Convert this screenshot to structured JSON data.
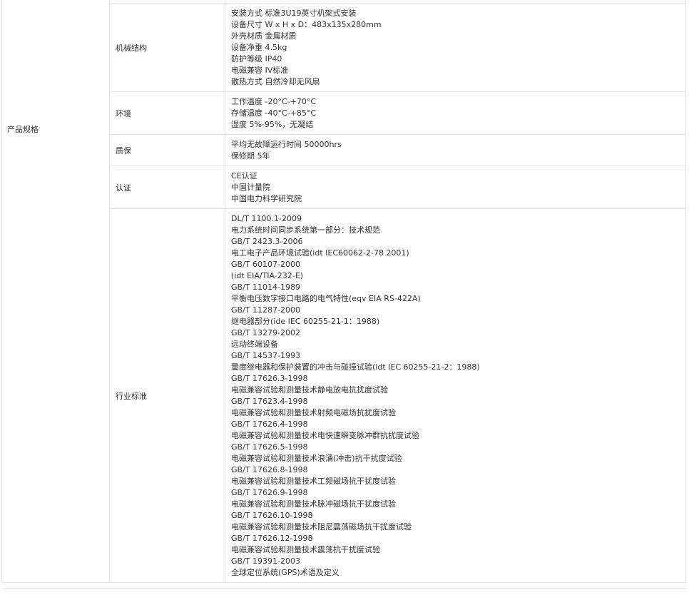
{
  "category": "产品规格",
  "sections": [
    {
      "label": "机械结构",
      "lines": [
        "安装方式 标准3U19英寸机架式安装",
        "设备尺寸 W x H x D：483x135x280mm",
        "外壳材质 金属材质",
        "设备净重 4.5kg",
        "防护等级 IP40",
        "电磁兼容 IV标准",
        "散热方式 自然冷却无风扇"
      ]
    },
    {
      "label": "环境",
      "lines": [
        "工作温度 -20°C-+70°C",
        "存储温度 -40°C-+85°C",
        "湿度 5%-95%，无凝结"
      ]
    },
    {
      "label": "质保",
      "lines": [
        "平均无故障运行时间 50000hrs",
        "保修期 5年"
      ]
    },
    {
      "label": "认证",
      "lines": [
        "CE认证",
        "中国计量院",
        "中国电力科学研究院"
      ]
    },
    {
      "label": "行业标准",
      "lines": [
        "DL/T 1100.1-2009",
        "电力系统时间同步系统第一部分：技术规范",
        "GB/T 2423.3-2006",
        "电工电子产品环境试验(idt IEC60062-2-78 2001)",
        "GB/T 60107-2000",
        "(idt EIA/TIA-232-E)",
        "GB/T 11014-1989",
        "平衡电压数字接口电路的电气特性(eqv EIA RS-422A)",
        "GB/T 11287-2000",
        "继电器部分(ide IEC 60255-21-1：1988)",
        "GB/T 13279-2002",
        "远动终端设备",
        "GB/T 14537-1993",
        "量度继电器和保护装置的冲击与碰撞试验(idt IEC 60255-21-2：1988)",
        "GB/T 17626.3-1998",
        "电磁兼容试验和测量技术静电放电抗扰度试验",
        "GB/T 17623.4-1998",
        "电磁兼容试验和测量技术射频电磁场抗扰度试验",
        "GB/T 17626.4-1998",
        "电磁兼容试验和测量技术电快速瞬变脉冲群抗扰度试验",
        "GB/T 17626.5-1998",
        "电磁兼容试验和测量技术浪涌(冲击)抗干扰度试验",
        "GB/T 17626.8-1998",
        "电磁兼容试验和测量技术工频磁场抗干扰度试验",
        "GB/T 17626.9-1998",
        "电磁兼容试验和测量技术脉冲磁场抗干扰度试验",
        "GB/T 17626.10-1998",
        "电磁兼容试验和测量技术阻尼震荡磁场抗干扰度试验",
        "GB/T 17626.12-1998",
        "电磁兼容试验和测量技术震荡抗干扰度试验",
        "GB/T 19391-2003",
        "全球定位系统(GPS)术语及定义"
      ]
    }
  ]
}
